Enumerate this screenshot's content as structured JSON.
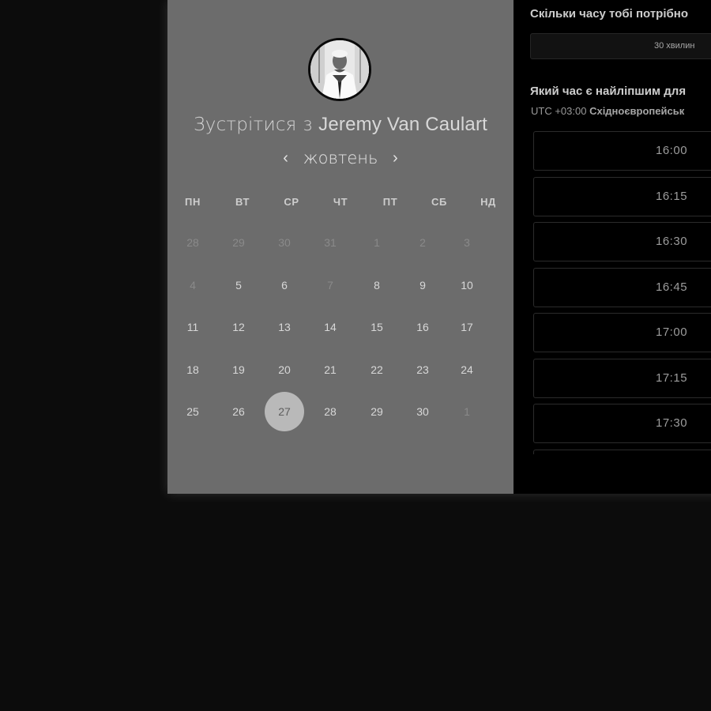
{
  "host_card": {
    "title_prefix": "Зустрітися з",
    "host_name": "Jeremy Van Caulart",
    "month_label": "жовтень",
    "prev_glyph": "‹",
    "next_glyph": "›"
  },
  "calendar": {
    "weekdays": [
      "ПН",
      "ВТ",
      "СР",
      "ЧТ",
      "ПТ",
      "СБ",
      "НД"
    ],
    "weeks": [
      [
        {
          "d": "28",
          "m": true
        },
        {
          "d": "29",
          "m": true
        },
        {
          "d": "30",
          "m": true
        },
        {
          "d": "31",
          "m": true
        },
        {
          "d": "1",
          "m": true
        },
        {
          "d": "2",
          "m": true
        },
        {
          "d": "3",
          "m": true
        }
      ],
      [
        {
          "d": "4",
          "m": true
        },
        {
          "d": "5"
        },
        {
          "d": "6"
        },
        {
          "d": "7",
          "m": true
        },
        {
          "d": "8"
        },
        {
          "d": "9"
        },
        {
          "d": "10"
        }
      ],
      [
        {
          "d": "11"
        },
        {
          "d": "12"
        },
        {
          "d": "13"
        },
        {
          "d": "14"
        },
        {
          "d": "15"
        },
        {
          "d": "16"
        },
        {
          "d": "17"
        }
      ],
      [
        {
          "d": "18"
        },
        {
          "d": "19"
        },
        {
          "d": "20"
        },
        {
          "d": "21"
        },
        {
          "d": "22"
        },
        {
          "d": "23"
        },
        {
          "d": "24"
        }
      ],
      [
        {
          "d": "25"
        },
        {
          "d": "26"
        },
        {
          "d": "27",
          "sel": true
        },
        {
          "d": "28"
        },
        {
          "d": "29"
        },
        {
          "d": "30"
        },
        {
          "d": "1",
          "m": true
        }
      ]
    ],
    "selected_day": "27"
  },
  "booking": {
    "duration_question": "Скільки часу тобі потрібно",
    "duration_value": "30 хвилин",
    "time_question": "Який час є найліпшим для",
    "tz_offset": "UTC +03:00",
    "tz_name": "Східноєвропейськ",
    "slots": [
      "16:00",
      "16:15",
      "16:30",
      "16:45",
      "17:00",
      "17:15",
      "17:30",
      ""
    ]
  },
  "colors": {
    "page_bg": "#0c0c0c",
    "calendar_panel": "#6c6c6c",
    "selected_day": "#b9b9b9",
    "right_panel": "#000000"
  }
}
